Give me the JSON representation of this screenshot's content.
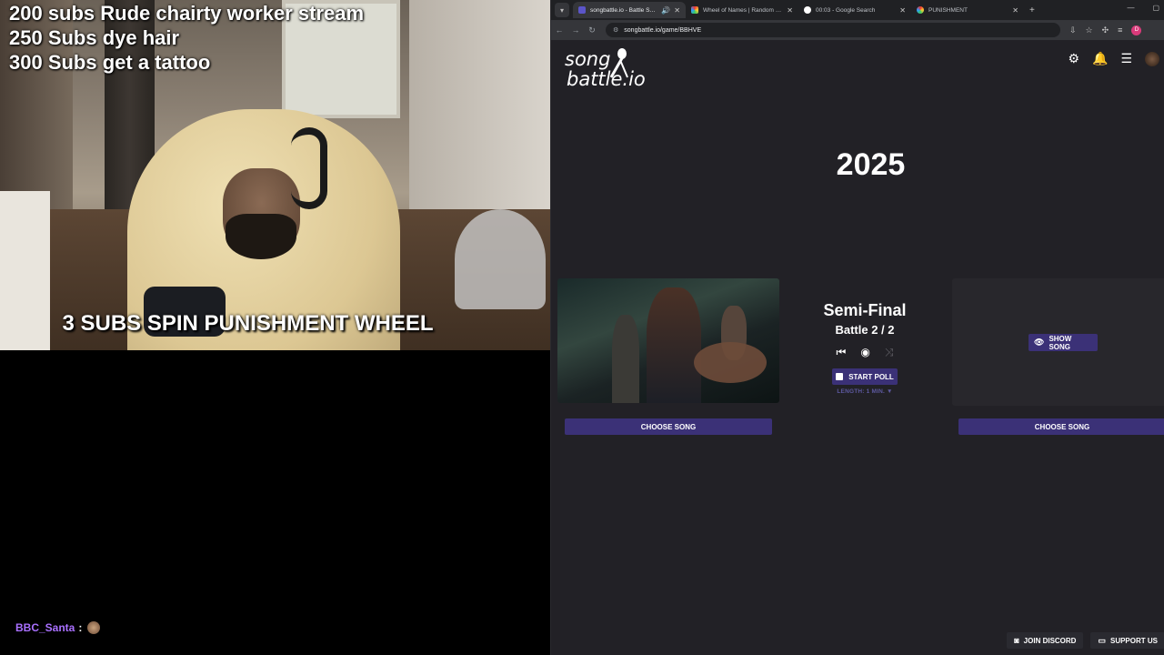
{
  "stream": {
    "goals": [
      "200 subs Rude chairty worker stream",
      "250 Subs dye hair",
      "300 Subs get a tattoo"
    ],
    "wheel_banner": "3 SUBS SPIN PUNISHMENT WHEEL",
    "chat": {
      "user": "BBC_Santa",
      "separator": ":",
      "user_color": "#a970ff"
    }
  },
  "browser": {
    "tabs": [
      {
        "title": "songbattle.io - Battle Songs",
        "active": true,
        "icon": "songbattle-favicon"
      },
      {
        "title": "Wheel of Names | Random name picker",
        "active": false,
        "icon": "wheel-favicon"
      },
      {
        "title": "00:03 - Google Search",
        "active": false,
        "icon": "google-favicon"
      },
      {
        "title": "PUNISHMENT",
        "active": false,
        "icon": "wheel-favicon"
      }
    ],
    "url": "songbattle.io/game/BBHVE"
  },
  "site": {
    "logo_line1": "song",
    "logo_line2": "battle.io",
    "year": "2025",
    "round_title": "Semi-Final",
    "battle_count": "Battle 2 / 2",
    "start_poll": "START POLL",
    "length": "LENGTH: 1 MIN. ▼",
    "show_song": "SHOW SONG",
    "choose_left": "CHOOSE SONG",
    "choose_right": "CHOOSE SONG",
    "join_discord": "JOIN DISCORD",
    "support_us": "SUPPORT US",
    "accent_color": "#3b3177"
  }
}
